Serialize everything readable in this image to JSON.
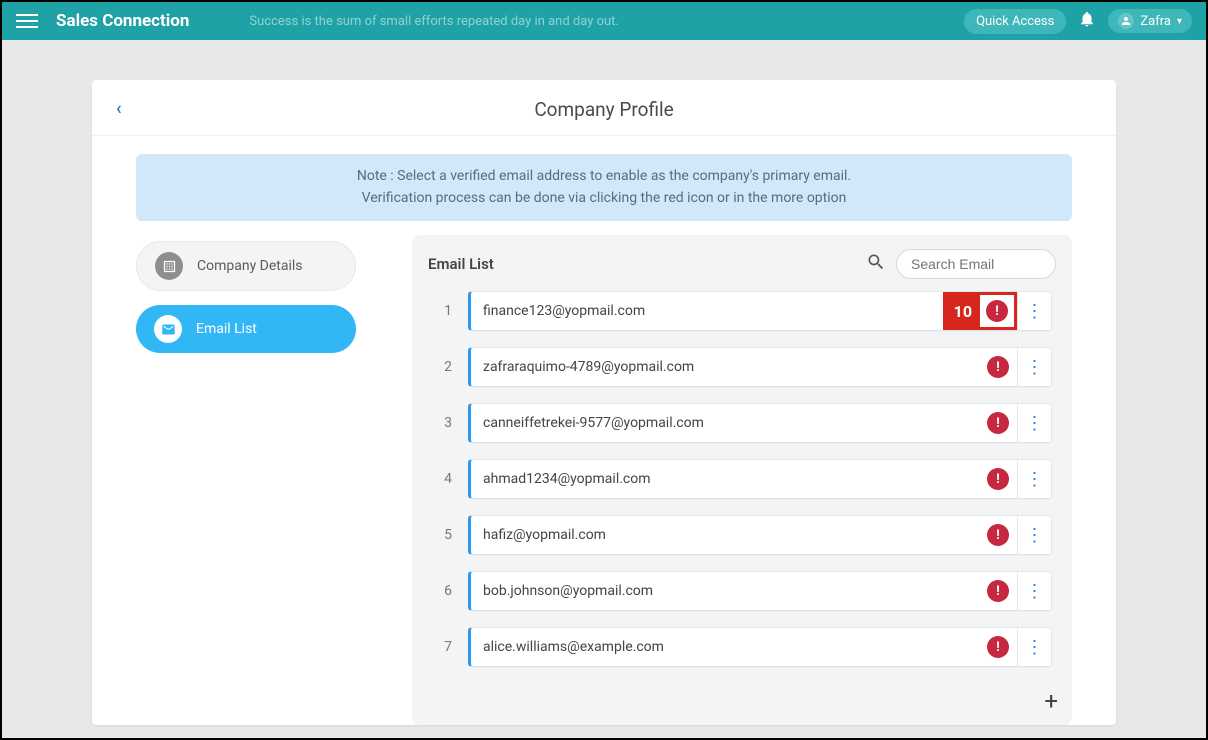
{
  "topbar": {
    "brand": "Sales Connection",
    "tagline": "Success is the sum of small efforts repeated day in and day out.",
    "quick_access": "Quick Access",
    "user_name": "Zafra"
  },
  "page": {
    "title": "Company Profile",
    "note_line1": "Note : Select a verified email address to enable as the company's primary email.",
    "note_line2": "Verification process can be done via clicking the red icon or in the more option"
  },
  "sidebar": {
    "items": [
      {
        "label": "Company Details",
        "active": false
      },
      {
        "label": "Email List",
        "active": true
      }
    ]
  },
  "list": {
    "title": "Email List",
    "search_placeholder": "Search Email",
    "rows": [
      {
        "num": "1",
        "email": "finance123@yopmail.com",
        "highlight_badge": "10"
      },
      {
        "num": "2",
        "email": "zafraraquimo-4789@yopmail.com"
      },
      {
        "num": "3",
        "email": "canneiffetrekei-9577@yopmail.com"
      },
      {
        "num": "4",
        "email": "ahmad1234@yopmail.com"
      },
      {
        "num": "5",
        "email": "hafiz@yopmail.com"
      },
      {
        "num": "6",
        "email": "bob.johnson@yopmail.com"
      },
      {
        "num": "7",
        "email": "alice.williams@example.com"
      }
    ]
  }
}
